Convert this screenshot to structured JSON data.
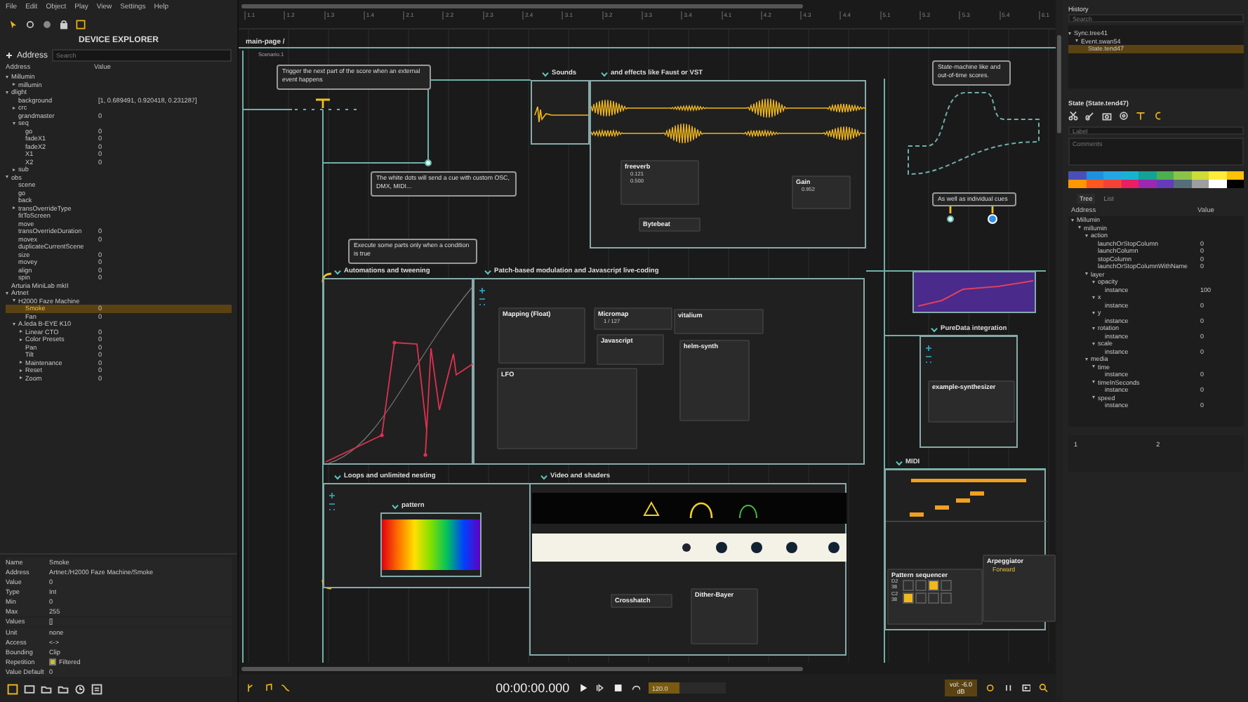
{
  "menu": [
    "File",
    "Edit",
    "Object",
    "Play",
    "View",
    "Settings",
    "Help"
  ],
  "device_explorer": {
    "title": "DEVICE EXPLORER",
    "add_label": "Address",
    "search_placeholder": "Search",
    "columns": [
      "Address",
      "Value"
    ],
    "tree": [
      {
        "name": "Millumin",
        "expanded": true,
        "selected": false,
        "children": [
          {
            "name": "millumin",
            "expanded": false,
            "selected": false
          }
        ]
      },
      {
        "name": "dlight",
        "expanded": true,
        "selected": false,
        "children": [
          {
            "name": "background",
            "value": "[1, 0.689491, 0.920418, 0.231287]",
            "selected": false
          },
          {
            "name": "crc",
            "expanded": false,
            "selected": false
          },
          {
            "name": "grandmaster",
            "value": "0",
            "selected": false
          },
          {
            "name": "seq",
            "expanded": true,
            "selected": false,
            "children": [
              {
                "name": "go",
                "value": "0",
                "selected": false
              },
              {
                "name": "fadeX1",
                "value": "0",
                "selected": false
              },
              {
                "name": "fadeX2",
                "value": "0",
                "selected": false
              },
              {
                "name": "X1",
                "value": "0",
                "selected": false
              },
              {
                "name": "X2",
                "value": "0",
                "selected": false
              }
            ]
          },
          {
            "name": "sub",
            "expanded": false,
            "selected": false
          }
        ]
      },
      {
        "name": "obs",
        "expanded": true,
        "selected": false,
        "children": [
          {
            "name": "scene",
            "selected": false
          },
          {
            "name": "go",
            "selected": false
          },
          {
            "name": "back",
            "selected": false
          },
          {
            "name": "transOverrideType",
            "expanded": false,
            "selected": false
          },
          {
            "name": "fitToScreen",
            "selected": false
          },
          {
            "name": "move",
            "selected": false
          },
          {
            "name": "transOverrideDuration",
            "value": "0",
            "selected": false
          },
          {
            "name": "movex",
            "value": "0",
            "selected": false
          },
          {
            "name": "duplicateCurrentScene",
            "selected": false
          },
          {
            "name": "size",
            "value": "0",
            "selected": false
          },
          {
            "name": "movey",
            "value": "0",
            "selected": false
          },
          {
            "name": "align",
            "value": "0",
            "selected": false
          },
          {
            "name": "spin",
            "value": "0",
            "selected": false
          }
        ]
      },
      {
        "name": "Arturia MiniLab mkII",
        "selected": false
      },
      {
        "name": "Artnet",
        "expanded": true,
        "selected": false,
        "children": [
          {
            "name": "H2000 Faze Machine",
            "expanded": true,
            "selected": false,
            "children": [
              {
                "name": "Smoke",
                "value": "0",
                "selected": true
              },
              {
                "name": "Fan",
                "value": "0",
                "selected": false
              }
            ]
          },
          {
            "name": "A.leda B-EYE K10",
            "expanded": true,
            "selected": false,
            "children": [
              {
                "name": "Linear CTO",
                "value": "0",
                "expanded": false,
                "selected": false
              },
              {
                "name": "Color Presets",
                "value": "0",
                "expanded": false,
                "selected": false
              },
              {
                "name": "Pan",
                "value": "0",
                "selected": false
              },
              {
                "name": "Tilt",
                "value": "0",
                "selected": false
              },
              {
                "name": "Maintenance",
                "value": "0",
                "expanded": false,
                "selected": false
              },
              {
                "name": "Reset",
                "value": "0",
                "expanded": false,
                "selected": false
              },
              {
                "name": "Zoom",
                "value": "0",
                "expanded": false,
                "selected": false
              }
            ]
          }
        ]
      }
    ]
  },
  "inspector": [
    {
      "label": "Name",
      "value": "Smoke"
    },
    {
      "label": "Address",
      "value": "Artnet:/H2000 Faze Machine/Smoke"
    },
    {
      "label": "Value",
      "value": "0"
    },
    {
      "label": "Type",
      "value": "Int"
    },
    {
      "label": "Min",
      "value": "0"
    },
    {
      "label": "Max",
      "value": "255"
    },
    {
      "label": "Values",
      "value": "[]"
    },
    {
      "label": "Unit",
      "value": "none"
    },
    {
      "label": "Access",
      "value": "<->"
    },
    {
      "label": "Bounding",
      "value": "Clip"
    },
    {
      "label": "Repetition",
      "value": "Filtered",
      "kind": "checkbox",
      "checked": true
    },
    {
      "label": "Value Default",
      "value": "0"
    }
  ],
  "score": {
    "breadcrumb": "main-page /",
    "scenario": "Scenario.1",
    "ruler": [
      "1.1",
      "1.2",
      "1.3",
      "1.4",
      "2.1",
      "2.2",
      "2.3",
      "2.4",
      "3.1",
      "3.2",
      "3.3",
      "3.4",
      "4.1",
      "4.2",
      "4.3",
      "4.4",
      "5.1",
      "5.2",
      "5.3",
      "5.4",
      "6.1"
    ],
    "comments": [
      "Trigger the next part of the score when an external event happens",
      "The white dots will send a cue with custom OSC, DMX, MIDI...",
      "Execute some parts only when a condition is true",
      "State-machine like and out-of-time scores.",
      "As well as individual cues"
    ],
    "sections": [
      {
        "title": "Sounds",
        "kind": "audio"
      },
      {
        "title": "and effects like Faust or VST",
        "kind": "audio"
      },
      {
        "title": "Automations and tweening",
        "kind": "automation"
      },
      {
        "title": "Patch-based modulation and Javascript live-coding",
        "kind": "patch"
      },
      {
        "title": "Loops and unlimited nesting",
        "kind": "loop"
      },
      {
        "title": "Video and shaders",
        "kind": "video"
      },
      {
        "title": "PureData integration",
        "kind": "patch"
      },
      {
        "title": "MIDI",
        "kind": "midi"
      },
      {
        "title": "pattern",
        "kind": "gradient"
      }
    ],
    "nodes": [
      {
        "title": "freeverb",
        "values": [
          "0.121",
          "0.500"
        ]
      },
      {
        "title": "Gain",
        "values": [
          "0.952"
        ]
      },
      {
        "title": "Bytebeat"
      },
      {
        "title": "Mapping (Float)"
      },
      {
        "title": "Micromap",
        "values": [
          "1 / 127"
        ]
      },
      {
        "title": "Javascript"
      },
      {
        "title": "vitalium"
      },
      {
        "title": "helm-synth"
      },
      {
        "title": "LFO"
      },
      {
        "title": "Crosshatch"
      },
      {
        "title": "Dither-Bayer"
      },
      {
        "title": "example-synthesizer"
      },
      {
        "title": "Pattern sequencer",
        "rows": [
          {
            "note": "D2",
            "velocity": "38",
            "steps": [
              false,
              false,
              true,
              false
            ]
          },
          {
            "note": "C2",
            "velocity": "38",
            "steps": [
              true,
              false,
              false,
              false
            ]
          }
        ]
      },
      {
        "title": "Arpeggiator",
        "values": [
          "Forward"
        ]
      }
    ]
  },
  "transport": {
    "time": "00:00:00.000",
    "tempo": "120.0",
    "volume": "vol: -6.0 dB"
  },
  "history": {
    "title": "History",
    "search_placeholder": "Search",
    "tree": [
      {
        "name": "Sync.tree41",
        "expanded": true,
        "selected": false,
        "children": [
          {
            "name": "Event.swan54",
            "expanded": true,
            "selected": false,
            "children": [
              {
                "name": "State.tend47",
                "selected": true
              }
            ]
          }
        ]
      }
    ]
  },
  "state": {
    "title": "State (State.tend47)",
    "label_placeholder": "Label",
    "comments_placeholder": "Comments",
    "palette": [
      {
        "color": "#4a4fb5"
      },
      {
        "color": "#1e90e0"
      },
      {
        "color": "#25a6e6"
      },
      {
        "color": "#16b4d2"
      },
      {
        "color": "#12a396"
      },
      {
        "color": "#4caf50"
      },
      {
        "color": "#8bc34a"
      },
      {
        "color": "#cddc39"
      },
      {
        "color": "#ffeb3b"
      },
      {
        "color": "#ffc107"
      },
      {
        "color": "#ff9800"
      },
      {
        "color": "#ff5722"
      },
      {
        "color": "#f44336"
      },
      {
        "color": "#e91e63"
      },
      {
        "color": "#9c27b0"
      },
      {
        "color": "#673ab7"
      },
      {
        "color": "#546e7a"
      },
      {
        "color": "#9e9e9e"
      },
      {
        "color": "#ffffff"
      },
      {
        "color": "#000000"
      }
    ],
    "tabs": [
      {
        "label": "Tree",
        "selected": true
      },
      {
        "label": "List",
        "selected": false
      }
    ],
    "columns": [
      "Address",
      "Value"
    ],
    "tree": [
      {
        "name": "Millumin",
        "expanded": true,
        "selected": false,
        "children": [
          {
            "name": "millumin",
            "expanded": true,
            "selected": false,
            "children": [
              {
                "name": "action",
                "expanded": true,
                "selected": false,
                "children": [
                  {
                    "name": "launchOrStopColumn",
                    "value": "0",
                    "selected": false
                  },
                  {
                    "name": "launchColumn",
                    "value": "0",
                    "selected": false
                  },
                  {
                    "name": "stopColumn",
                    "value": "0",
                    "selected": false
                  },
                  {
                    "name": "launchOrStopColumnWithName",
                    "value": "0",
                    "selected": false
                  }
                ]
              },
              {
                "name": "layer",
                "expanded": true,
                "selected": false,
                "children": [
                  {
                    "name": "opacity",
                    "expanded": true,
                    "selected": false,
                    "children": [
                      {
                        "name": "instance",
                        "value": "100",
                        "selected": false
                      }
                    ]
                  },
                  {
                    "name": "x",
                    "expanded": true,
                    "selected": false,
                    "children": [
                      {
                        "name": "instance",
                        "value": "0",
                        "selected": false
                      }
                    ]
                  },
                  {
                    "name": "y",
                    "expanded": true,
                    "selected": false,
                    "children": [
                      {
                        "name": "instance",
                        "value": "0",
                        "selected": false
                      }
                    ]
                  },
                  {
                    "name": "rotation",
                    "expanded": true,
                    "selected": false,
                    "children": [
                      {
                        "name": "instance",
                        "value": "0",
                        "selected": false
                      }
                    ]
                  },
                  {
                    "name": "scale",
                    "expanded": true,
                    "selected": false,
                    "children": [
                      {
                        "name": "instance",
                        "value": "0",
                        "selected": false
                      }
                    ]
                  }
                ]
              },
              {
                "name": "media",
                "expanded": true,
                "selected": false,
                "children": [
                  {
                    "name": "time",
                    "expanded": true,
                    "selected": false,
                    "children": [
                      {
                        "name": "instance",
                        "value": "0",
                        "selected": false
                      }
                    ]
                  },
                  {
                    "name": "timeInSeconds",
                    "expanded": true,
                    "selected": false,
                    "children": [
                      {
                        "name": "instance",
                        "value": "0",
                        "selected": false
                      }
                    ]
                  },
                  {
                    "name": "speed",
                    "expanded": true,
                    "selected": false,
                    "children": [
                      {
                        "name": "instance",
                        "value": "0",
                        "selected": false
                      }
                    ]
                  }
                ]
              }
            ]
          }
        ]
      }
    ],
    "table_row": [
      "1",
      "2"
    ]
  }
}
